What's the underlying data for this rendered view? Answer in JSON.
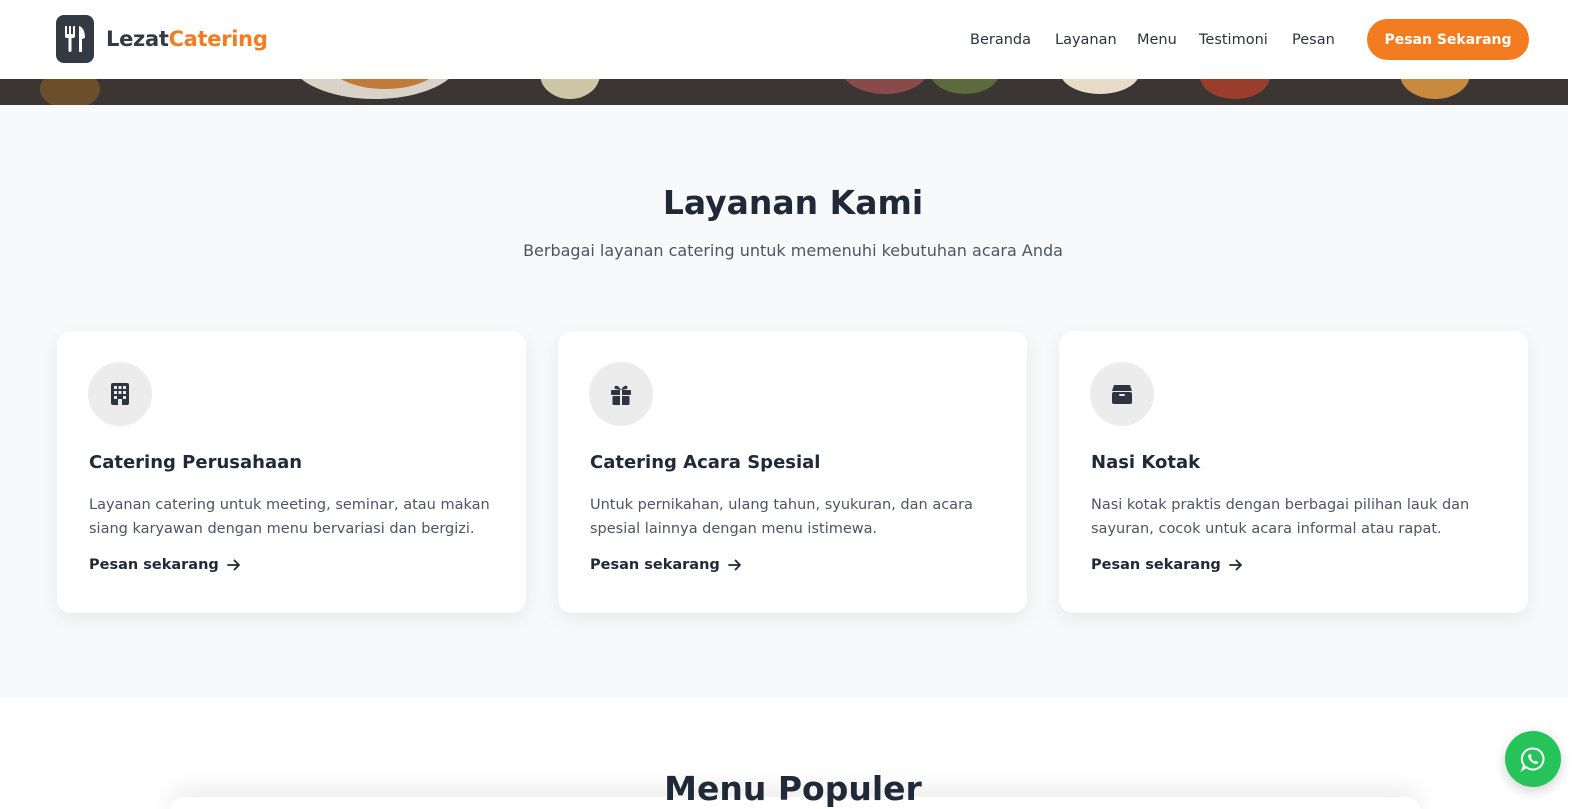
{
  "brand": {
    "name_part1": "Lezat",
    "name_part2": "Catering",
    "accent": "#f47c20",
    "dark": "#333a44"
  },
  "nav": {
    "items": [
      "Beranda",
      "Layanan",
      "Menu",
      "Testimoni",
      "Pesan"
    ],
    "cta_label": "Pesan Sekarang"
  },
  "services": {
    "title": "Layanan Kami",
    "subtitle": "Berbagai layanan catering untuk memenuhi kebutuhan acara Anda",
    "cards": [
      {
        "icon": "building-icon",
        "title": "Catering Perusahaan",
        "desc": "Layanan catering untuk meeting, seminar, atau makan siang karyawan dengan menu bervariasi dan bergizi.",
        "link": "Pesan sekarang"
      },
      {
        "icon": "gift-icon",
        "title": "Catering Acara Spesial",
        "desc": "Untuk pernikahan, ulang tahun, syukuran, dan acara spesial lainnya dengan menu istimewa.",
        "link": "Pesan sekarang"
      },
      {
        "icon": "box-icon",
        "title": "Nasi Kotak",
        "desc": "Nasi kotak praktis dengan berbagai pilihan lauk dan sayuran, cocok untuk acara informal atau rapat.",
        "link": "Pesan sekarang"
      }
    ]
  },
  "menu_section": {
    "title": "Menu Populer"
  },
  "whatsapp": {
    "icon": "whatsapp-icon",
    "color": "#25c35a"
  }
}
